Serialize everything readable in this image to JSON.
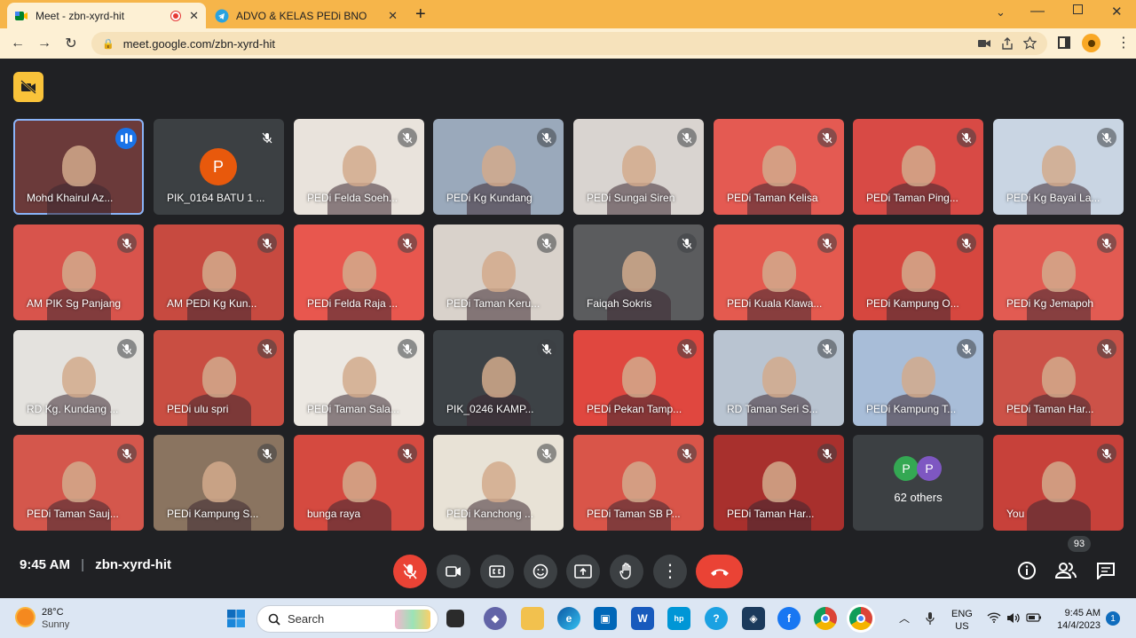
{
  "browser": {
    "tabs": [
      {
        "title": "Meet - zbn-xyrd-hit",
        "active": true
      },
      {
        "title": "ADVO & KELAS PEDi BNO",
        "active": false
      }
    ],
    "new_tab_label": "+",
    "url": "meet.google.com/zbn-xyrd-hit"
  },
  "meeting": {
    "time": "9:45 AM",
    "separator": "|",
    "code": "zbn-xyrd-hit",
    "people_count": "93",
    "others_label": "62 others",
    "others_initials": [
      "P",
      "P"
    ],
    "tiles": [
      {
        "name": "Mohd Khairul Az...",
        "bg": "#6b3a3a"
      },
      {
        "name": "PIK_0164 BATU 1 ...",
        "bg": "#3c4043",
        "avatar": "P",
        "avatar_color": "#e8590c"
      },
      {
        "name": "PEDi Felda Soeh...",
        "bg": "#e9e3dc"
      },
      {
        "name": "PEDi Kg Kundang",
        "bg": "#9aa9bb"
      },
      {
        "name": "PEDi Sungai Siren",
        "bg": "#d9d4d0"
      },
      {
        "name": "PEDi Taman Kelisa",
        "bg": "#e45a52"
      },
      {
        "name": "PEDi Taman Ping...",
        "bg": "#d84a45"
      },
      {
        "name": "PEDi Kg Bayai La...",
        "bg": "#c9d5e3"
      },
      {
        "name": "AM PIK Sg Panjang",
        "bg": "#d8544c"
      },
      {
        "name": "AM PEDi Kg Kun...",
        "bg": "#c74a40"
      },
      {
        "name": "PEDi Felda Raja ...",
        "bg": "#e8574e"
      },
      {
        "name": "PEDi Taman Keru...",
        "bg": "#d9d2cb"
      },
      {
        "name": "Faiqah Sokris",
        "bg": "#5b5c5e"
      },
      {
        "name": "PEDi Kuala Klawa...",
        "bg": "#e45a4f"
      },
      {
        "name": "PEDi Kampung O...",
        "bg": "#d6473f"
      },
      {
        "name": "PEDi Kg Jemapoh",
        "bg": "#e25b52"
      },
      {
        "name": "RD Kg. Kundang ...",
        "bg": "#e4e2de"
      },
      {
        "name": "PEDi ulu spri",
        "bg": "#c94e42"
      },
      {
        "name": "PEDi Taman Sala...",
        "bg": "#ece8e2"
      },
      {
        "name": "PIK_0246 KAMP...",
        "bg": "#3d4246"
      },
      {
        "name": "PEDi Pekan Tamp...",
        "bg": "#e0473f"
      },
      {
        "name": "RD Taman Seri S...",
        "bg": "#b9c4d1"
      },
      {
        "name": "PEDi Kampung T...",
        "bg": "#a8bdd8"
      },
      {
        "name": "PEDi Taman Har...",
        "bg": "#cc5248"
      },
      {
        "name": "PEDi Taman Sauj...",
        "bg": "#d4574c"
      },
      {
        "name": "PEDi Kampung S...",
        "bg": "#8a7460"
      },
      {
        "name": "bunga raya",
        "bg": "#d54a40"
      },
      {
        "name": "PEDi Kanchong ...",
        "bg": "#e8e2d6"
      },
      {
        "name": "PEDi Taman SB P...",
        "bg": "#d95549"
      },
      {
        "name": "PEDi Taman Har...",
        "bg": "#a8302d"
      },
      {
        "name": "",
        "bg": "#3c4043",
        "others": true
      },
      {
        "name": "You",
        "bg": "#c7413a"
      }
    ]
  },
  "taskbar": {
    "weather_temp": "28°C",
    "weather_desc": "Sunny",
    "search_placeholder": "Search",
    "lang_1": "ENG",
    "lang_2": "US",
    "time": "9:45 AM",
    "date": "14/4/2023",
    "notifications": "1"
  }
}
